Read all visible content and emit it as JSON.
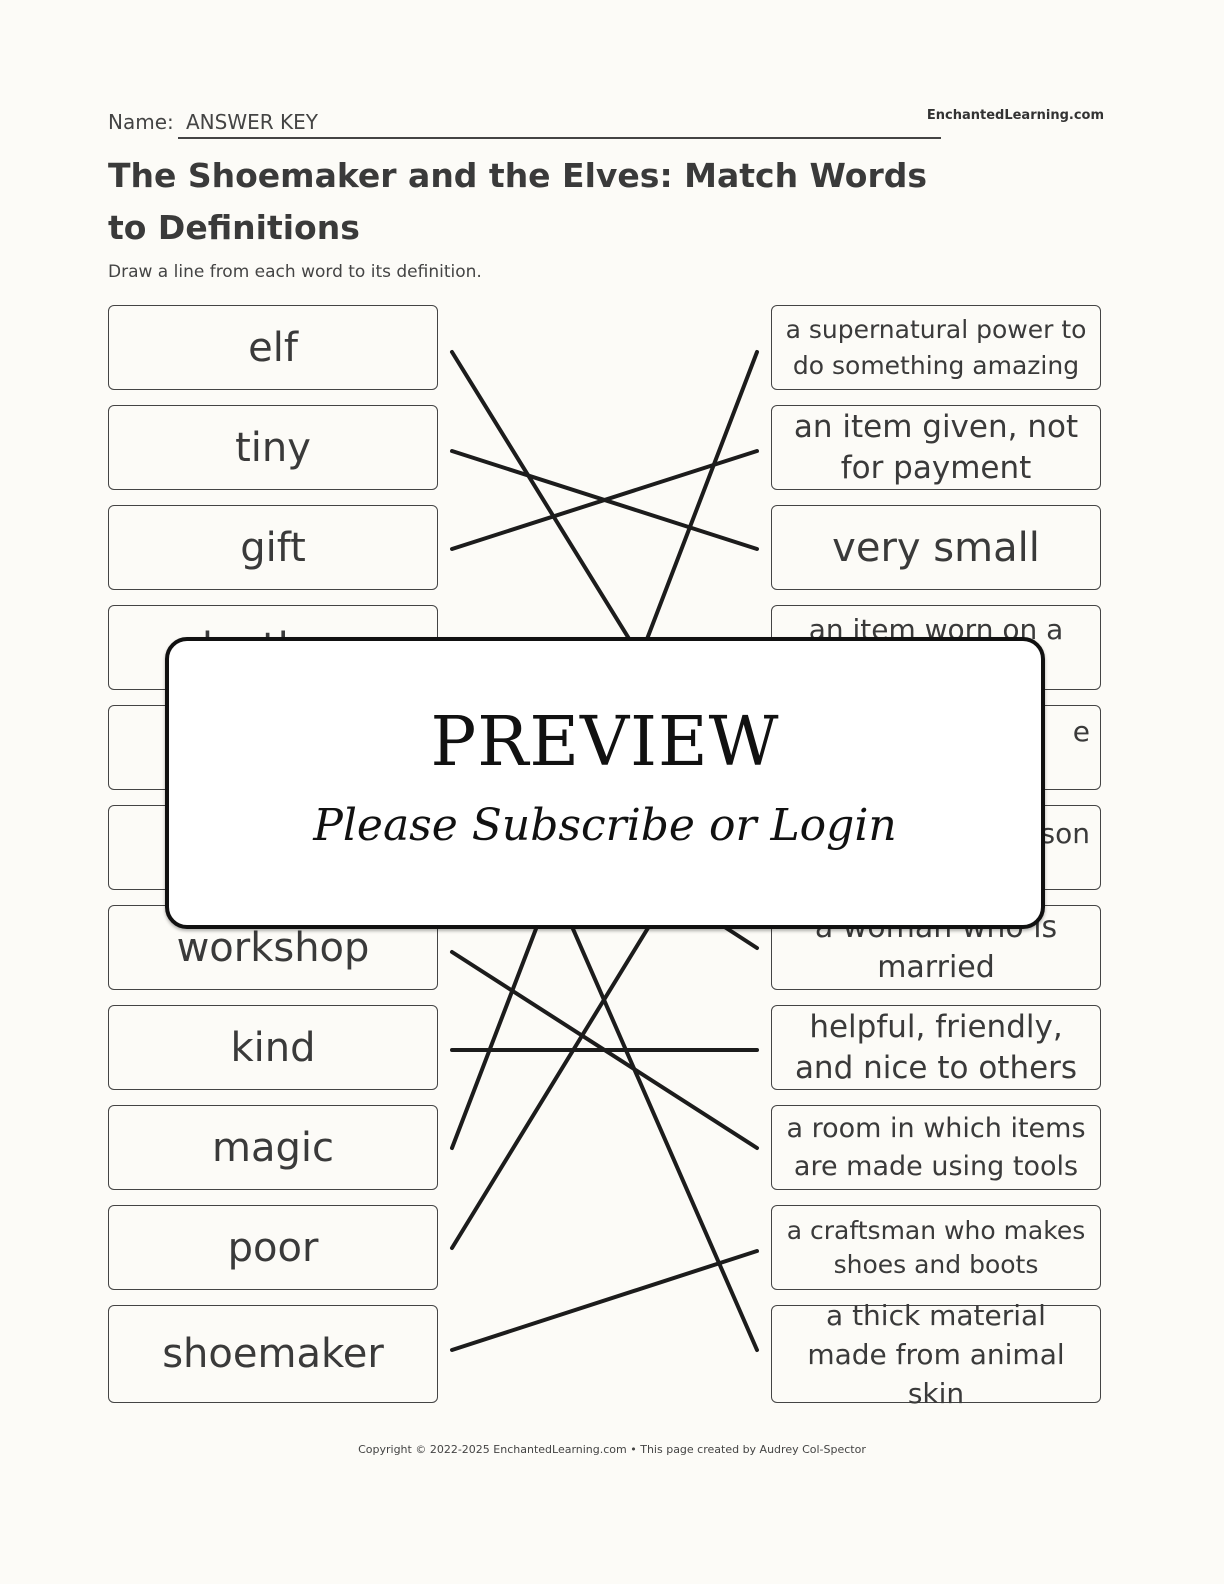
{
  "header": {
    "name_label": "Name:",
    "name_value": "ANSWER KEY",
    "brand": "EnchantedLearning.com"
  },
  "title": "The Shoemaker and the Elves: Match Words to Definitions",
  "instructions": "Draw a line from each word to its definition.",
  "words": [
    "elf",
    "tiny",
    "gift",
    "leather",
    "",
    "",
    "workshop",
    "kind",
    "magic",
    "poor",
    "shoemaker"
  ],
  "definitions": [
    "a supernatural power to do something amazing",
    "an item given, not for payment",
    "very small",
    "an item worn on a",
    "e",
    "son",
    "a woman who is married",
    "helpful, friendly, and nice to others",
    "a room in which items are made using tools",
    "a craftsman who makes shoes and boots",
    "a thick material made from animal skin"
  ],
  "matches": [
    {
      "word": "elf",
      "definition_index": 5
    },
    {
      "word": "tiny",
      "definition_index": 2
    },
    {
      "word": "gift",
      "definition_index": 1
    },
    {
      "word": "leather",
      "definition_index": 10
    },
    {
      "word": "workshop",
      "definition_index": 8
    },
    {
      "word": "kind",
      "definition_index": 7
    },
    {
      "word": "magic",
      "definition_index": 0
    },
    {
      "word": "poor",
      "definition_index": 5
    },
    {
      "word": "shoemaker",
      "definition_index": 9
    }
  ],
  "overlay": {
    "title": "PREVIEW",
    "subtitle": "Please Subscribe or Login"
  },
  "footer": "Copyright © 2022-2025 EnchantedLearning.com • This page created by Audrey Col-Spector"
}
